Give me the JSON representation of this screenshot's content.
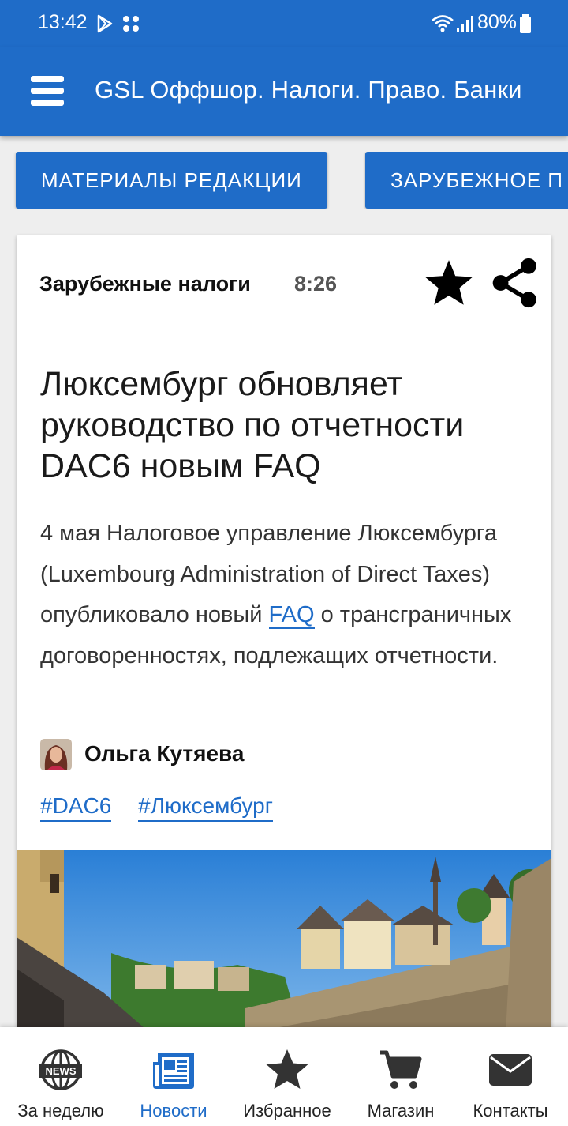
{
  "status_bar": {
    "time": "13:42",
    "battery": "80%"
  },
  "app_bar": {
    "title": "GSL Оффшор. Налоги. Право. Банки"
  },
  "categories": [
    "МАТЕРИАЛЫ РЕДАКЦИИ",
    "ЗАРУБЕЖНОЕ П"
  ],
  "article": {
    "category": "Зарубежные налоги",
    "time": "8:26",
    "headline": "Люксембург обновляет руководство по отчетности DAC6 новым FAQ",
    "body_before_link": "4 мая Налоговое управление Люксембурга (Luxembourg Administration of Direct Taxes) опубликовало новый ",
    "body_link": "FAQ",
    "body_after_link": " о трансграничных договоренностях, подлежащих отчетности.",
    "author": "Ольга Кутяева",
    "tags": [
      "#DAC6",
      "#Люксембург"
    ]
  },
  "bottom_nav": [
    {
      "label": "За неделю",
      "icon": "news-globe-icon"
    },
    {
      "label": "Новости",
      "icon": "newspaper-icon",
      "active": true
    },
    {
      "label": "Избранное",
      "icon": "star-icon"
    },
    {
      "label": "Магазин",
      "icon": "cart-icon"
    },
    {
      "label": "Контакты",
      "icon": "envelope-icon"
    }
  ],
  "colors": {
    "primary": "#1f6cc8",
    "active_nav": "#1f6cc8",
    "text": "#1a1a1a"
  }
}
